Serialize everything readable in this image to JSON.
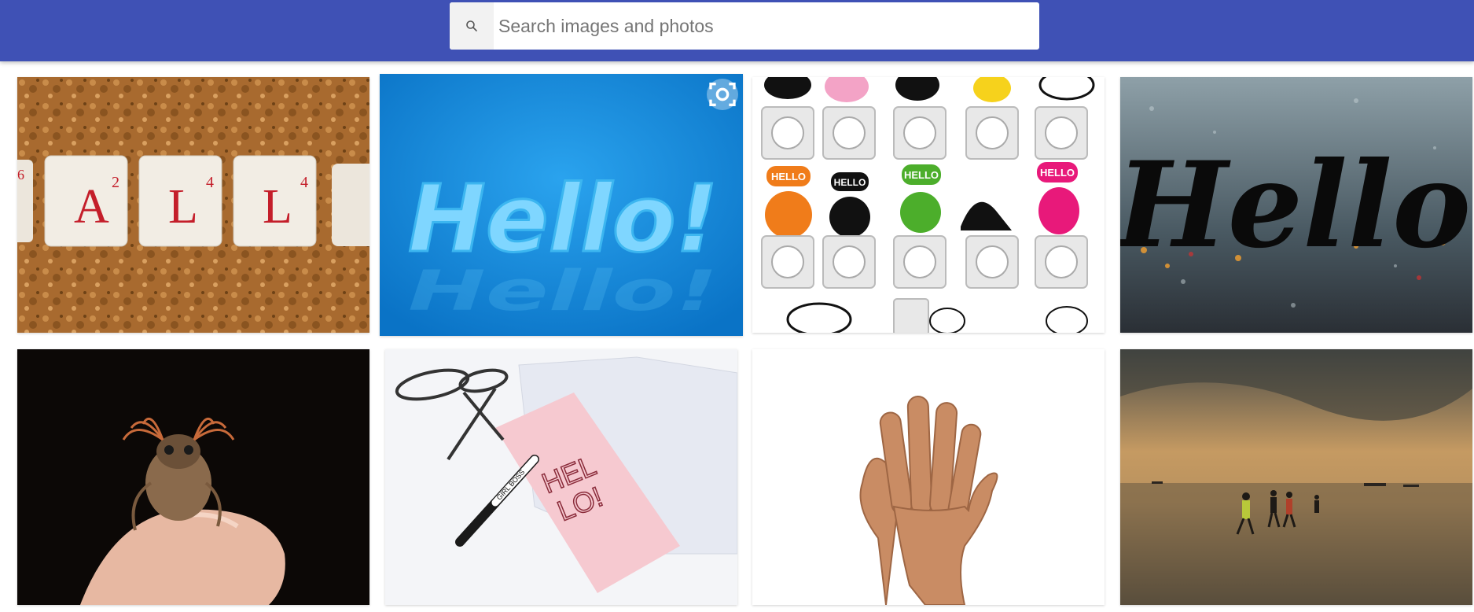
{
  "search": {
    "placeholder": "Search images and photos",
    "icon": "search-icon"
  },
  "images": [
    {
      "subject": "scrabble-tiles-hallo",
      "tiles": [
        "A",
        "L",
        "L"
      ],
      "tile_scores": [
        "2",
        "4",
        "4"
      ],
      "edge_score": "6"
    },
    {
      "subject": "blue-hello-3d-text",
      "text": "Hello!",
      "overlay_icon": "visual-search-icon"
    },
    {
      "subject": "cartoon-animal-switch-stickers",
      "bubbles": [
        "HELLO",
        "HELLO",
        "HELLO",
        "HELLO"
      ]
    },
    {
      "subject": "hello-written-on-rainy-glass",
      "text": "Hello"
    },
    {
      "subject": "beetle-on-fingertip"
    },
    {
      "subject": "hello-card-with-glasses-and-pen",
      "card_lines": [
        "HEL",
        "LO!"
      ],
      "pen_text": "GIRL BOSS"
    },
    {
      "subject": "waving-hand"
    },
    {
      "subject": "people-running-on-beach-sunset"
    }
  ],
  "colors": {
    "header": "#3f51b5",
    "accent_blue": "#1a86d8"
  }
}
